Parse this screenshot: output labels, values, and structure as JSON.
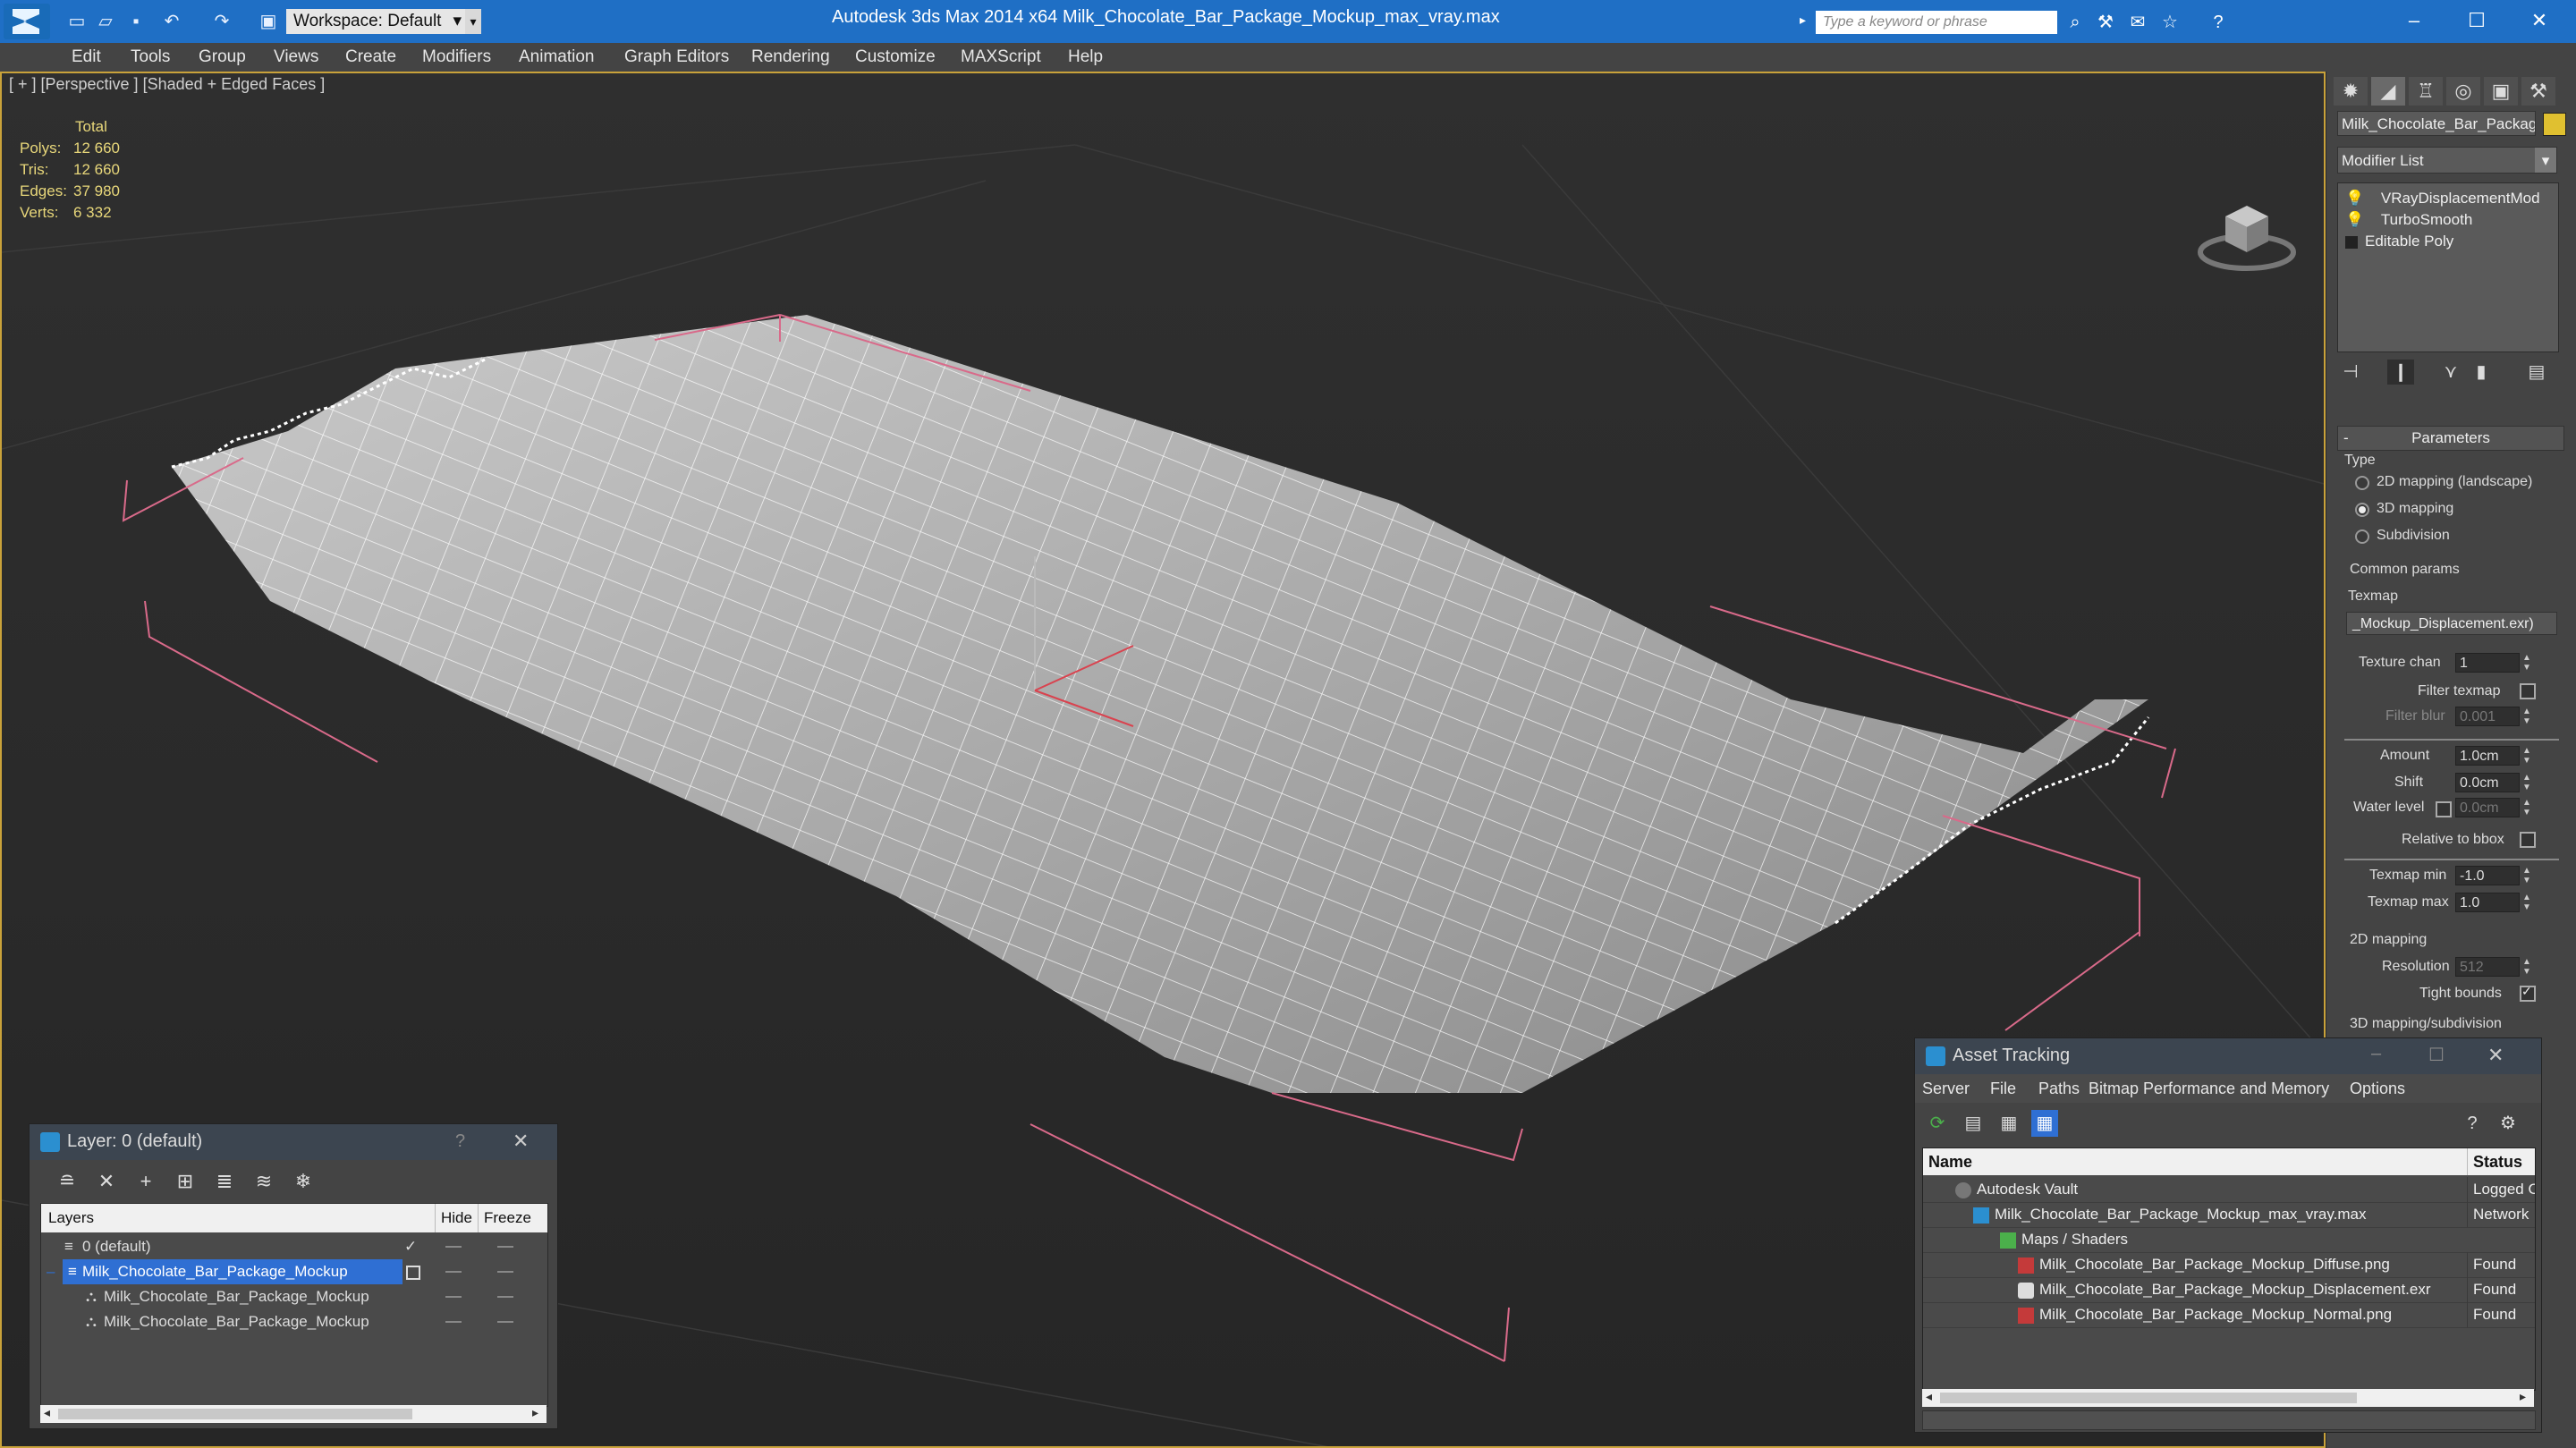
{
  "titlebar": {
    "workspace_label": "Workspace: Default",
    "app_title": "Autodesk 3ds Max  2014 x64      Milk_Chocolate_Bar_Package_Mockup_max_vray.max",
    "search_placeholder": "Type a keyword or phrase",
    "help_label": "?"
  },
  "menu": [
    "Edit",
    "Tools",
    "Group",
    "Views",
    "Create",
    "Modifiers",
    "Animation",
    "Graph Editors",
    "Rendering",
    "Customize",
    "MAXScript",
    "Help"
  ],
  "viewport": {
    "label": "[ + ] [Perspective ] [Shaded + Edged Faces ]",
    "stats": {
      "header": "Total",
      "rows": [
        {
          "label": "Polys:",
          "value": "12 660"
        },
        {
          "label": "Tris:",
          "value": "12 660"
        },
        {
          "label": "Edges:",
          "value": "37 980"
        },
        {
          "label": "Verts:",
          "value": "6 332"
        }
      ]
    }
  },
  "command_panel": {
    "object_name": "Milk_Chocolate_Bar_Package",
    "object_color": "#e0c030",
    "modifier_list_label": "Modifier List",
    "stack": [
      "VRayDisplacementMod",
      "TurboSmooth",
      "Editable Poly"
    ],
    "parameters_title": "Parameters",
    "type_label": "Type",
    "type_options": [
      {
        "label": "2D mapping (landscape)",
        "selected": false
      },
      {
        "label": "3D mapping",
        "selected": true
      },
      {
        "label": "Subdivision",
        "selected": false
      }
    ],
    "common_params_label": "Common params",
    "texmap_label": "Texmap",
    "texmap_value": "_Mockup_Displacement.exr)",
    "fields": {
      "texture_chan": {
        "label": "Texture chan",
        "value": "1"
      },
      "filter_texmap": {
        "label": "Filter texmap"
      },
      "filter_blur": {
        "label": "Filter blur",
        "value": "0.001"
      },
      "amount": {
        "label": "Amount",
        "value": "1.0cm"
      },
      "shift": {
        "label": "Shift",
        "value": "0.0cm"
      },
      "water_level": {
        "label": "Water level",
        "value": "0.0cm"
      },
      "relative_to_bbox": {
        "label": "Relative to bbox"
      },
      "texmap_min": {
        "label": "Texmap min",
        "value": "-1.0"
      },
      "texmap_max": {
        "label": "Texmap max",
        "value": "1.0"
      },
      "mapping_2d": {
        "label": "2D mapping"
      },
      "resolution": {
        "label": "Resolution",
        "value": "512"
      },
      "tight_bounds": {
        "label": "Tight bounds"
      },
      "mapping_3d": {
        "label": "3D mapping/subdivision"
      }
    }
  },
  "layer_dialog": {
    "title": "Layer: 0 (default)",
    "help": "?",
    "columns": {
      "layers": "Layers",
      "hide": "Hide",
      "freeze": "Freeze"
    },
    "rows": [
      {
        "name": "0 (default)",
        "indent": 0,
        "selected": false
      },
      {
        "name": "Milk_Chocolate_Bar_Package_Mockup",
        "indent": 0,
        "selected": true
      },
      {
        "name": "Milk_Chocolate_Bar_Package_Mockup",
        "indent": 1,
        "selected": false
      },
      {
        "name": "Milk_Chocolate_Bar_Package_Mockup",
        "indent": 1,
        "selected": false
      }
    ]
  },
  "asset_dialog": {
    "title": "Asset Tracking",
    "menu": [
      "Server",
      "File",
      "Paths",
      "Bitmap Performance and Memory",
      "Options"
    ],
    "columns": {
      "name": "Name",
      "status": "Status"
    },
    "rows": [
      {
        "name": "Autodesk Vault",
        "status": "Logged O",
        "indent": 1,
        "icon": "vault-icon"
      },
      {
        "name": "Milk_Chocolate_Bar_Package_Mockup_max_vray.max",
        "status": "Network",
        "indent": 2,
        "icon": "max-file-icon"
      },
      {
        "name": "Maps / Shaders",
        "status": "",
        "indent": 3,
        "icon": "maps-icon"
      },
      {
        "name": "Milk_Chocolate_Bar_Package_Mockup_Diffuse.png",
        "status": "Found",
        "indent": 4,
        "icon": "png-icon"
      },
      {
        "name": "Milk_Chocolate_Bar_Package_Mockup_Displacement.exr",
        "status": "Found",
        "indent": 4,
        "icon": "exr-icon"
      },
      {
        "name": "Milk_Chocolate_Bar_Package_Mockup_Normal.png",
        "status": "Found",
        "indent": 4,
        "icon": "png-icon"
      }
    ]
  }
}
